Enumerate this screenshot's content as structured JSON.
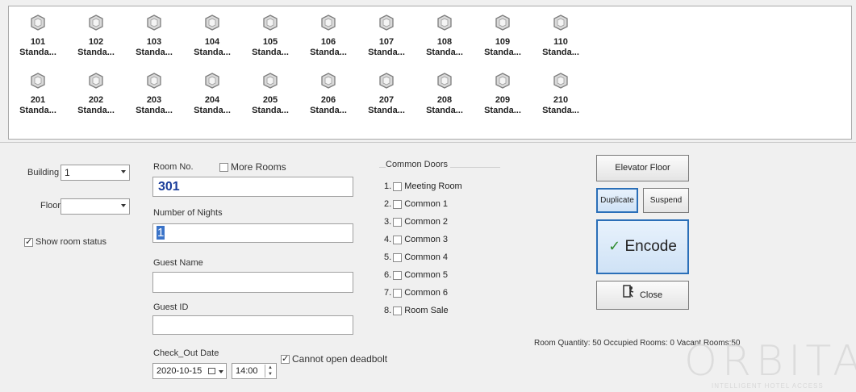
{
  "rooms": [
    {
      "number": "101",
      "type": "Standa..."
    },
    {
      "number": "102",
      "type": "Standa..."
    },
    {
      "number": "103",
      "type": "Standa..."
    },
    {
      "number": "104",
      "type": "Standa..."
    },
    {
      "number": "105",
      "type": "Standa..."
    },
    {
      "number": "106",
      "type": "Standa..."
    },
    {
      "number": "107",
      "type": "Standa..."
    },
    {
      "number": "108",
      "type": "Standa..."
    },
    {
      "number": "109",
      "type": "Standa..."
    },
    {
      "number": "110",
      "type": "Standa..."
    },
    {
      "number": "201",
      "type": "Standa..."
    },
    {
      "number": "202",
      "type": "Standa..."
    },
    {
      "number": "203",
      "type": "Standa..."
    },
    {
      "number": "204",
      "type": "Standa..."
    },
    {
      "number": "205",
      "type": "Standa..."
    },
    {
      "number": "206",
      "type": "Standa..."
    },
    {
      "number": "207",
      "type": "Standa..."
    },
    {
      "number": "208",
      "type": "Standa..."
    },
    {
      "number": "209",
      "type": "Standa..."
    },
    {
      "number": "210",
      "type": "Standa..."
    }
  ],
  "room_icon": "door-icon",
  "left": {
    "building_label": "Building",
    "building_value": "1",
    "floor_label": "Floor",
    "floor_value": "",
    "show_status_label": "Show room status",
    "show_status_checked": true
  },
  "form": {
    "room_no_label": "Room No.",
    "more_rooms_label": "More Rooms",
    "room_no_value": "301",
    "nights_label": "Number of Nights",
    "nights_value": "1",
    "guest_name_label": "Guest Name",
    "guest_name_value": "",
    "guest_id_label": "Guest ID",
    "guest_id_value": "",
    "checkout_label": "Check_Out Date",
    "checkout_date": "2020-10-15",
    "checkout_time": "14:00",
    "deadbolt_label": "Cannot open deadbolt",
    "deadbolt_checked": true
  },
  "common_doors": {
    "title": "Common Doors",
    "items": [
      {
        "index": "1.",
        "label": "Meeting Room"
      },
      {
        "index": "2.",
        "label": "Common 1"
      },
      {
        "index": "3.",
        "label": "Common 2"
      },
      {
        "index": "4.",
        "label": "Common 3"
      },
      {
        "index": "5.",
        "label": "Common 4"
      },
      {
        "index": "6.",
        "label": "Common 5"
      },
      {
        "index": "7.",
        "label": "Common 6"
      },
      {
        "index": "8.",
        "label": "Room Sale"
      }
    ]
  },
  "actions": {
    "elevator": "Elevator Floor",
    "duplicate": "Duplicate",
    "suspend": "Suspend",
    "encode": "Encode",
    "close": "Close"
  },
  "status": {
    "text": "Room Quantity: 50   Occupied Rooms: 0   Vacant Rooms:50"
  },
  "watermark": {
    "brand": "ORBITA",
    "tagline": "INTELLIGENT HOTEL ACCESS"
  },
  "colors": {
    "accent": "#2b6fb8",
    "check": "#2e8b2e"
  }
}
